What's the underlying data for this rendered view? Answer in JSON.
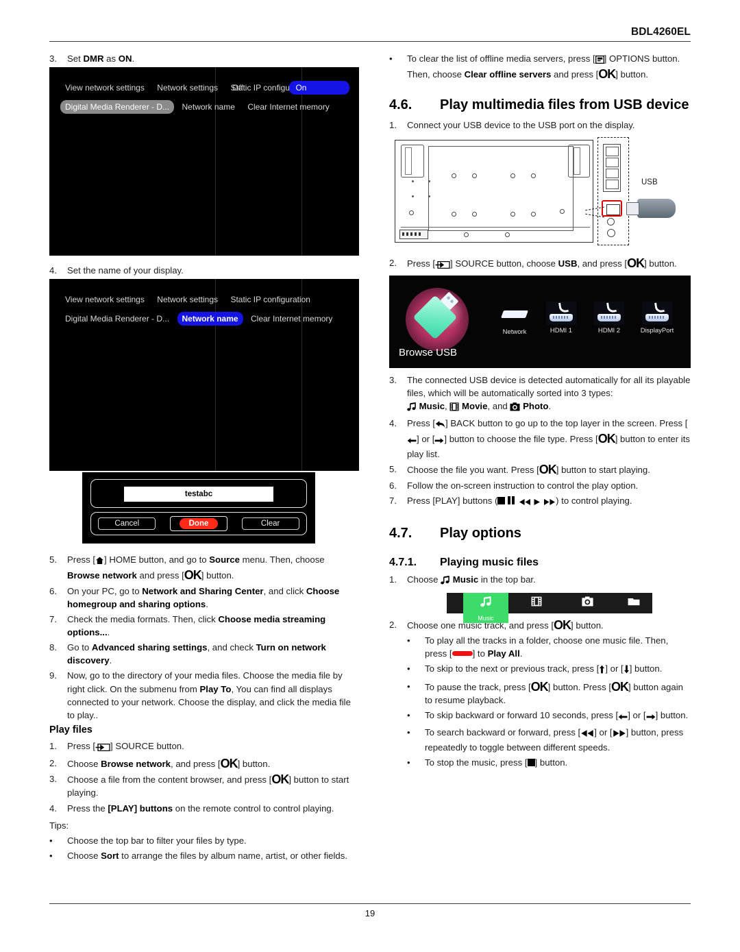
{
  "header": {
    "model": "BDL4260EL"
  },
  "footer": {
    "page_number": "19"
  },
  "left": {
    "step3": {
      "num": "3.",
      "pre": "Set ",
      "b1": "DMR",
      "mid": " as ",
      "b2": "ON",
      "post": "."
    },
    "osd1": {
      "items": [
        "View network settings",
        "Network settings",
        "Static IP configuration",
        "Digital Media Renderer - D...",
        "Network name",
        "Clear Internet memory"
      ],
      "selected_index": 3,
      "options": [
        "Off",
        "On"
      ],
      "option_selected": "On"
    },
    "step4": {
      "num": "4.",
      "text": "Set the name of your display."
    },
    "osd2": {
      "items": [
        "View network settings",
        "Network settings",
        "Static IP configuration",
        "Digital Media Renderer - D...",
        "Network name",
        "Clear Internet memory"
      ],
      "selected_index": 4
    },
    "keyboard_dialog": {
      "field_value": "testabc",
      "cancel": "Cancel",
      "done": "Done",
      "clear": "Clear"
    },
    "step5": {
      "num": "5.",
      "p1": "Press ",
      "icon": "home-icon",
      "p2": "] HOME button, and go to ",
      "b1": "Source",
      "p3": " menu. Then, choose ",
      "b2": "Browse network",
      "p4": " and press [",
      "ok": "OK",
      "p5": "] button."
    },
    "step6": {
      "num": "6.",
      "p1": "On your PC, go to ",
      "b1": "Network and Sharing Center",
      "p2": ", and click ",
      "b2": "Choose homegroup and sharing options",
      "p3": "."
    },
    "step7": {
      "num": "7.",
      "p1": "Check the media formats. Then, click ",
      "b1": "Choose media streaming options...",
      "p2": "."
    },
    "step8": {
      "num": "8.",
      "p1": "Go to ",
      "b1": "Advanced sharing settings",
      "p2": ", and check ",
      "b2": "Turn on network discovery",
      "p3": "."
    },
    "step9": {
      "num": "9.",
      "p1": "Now, go to the directory of your media files. Choose the media file by right click. On the submenu from ",
      "b1": "Play To",
      "p2": ", You can find all displays connected to your network. Choose the display, and click the media file to play.."
    },
    "play_files_title": "Play files",
    "pf1": {
      "num": "1.",
      "p1": "Press [",
      "icon": "source-icon",
      "p2": "] SOURCE button."
    },
    "pf2": {
      "num": "2.",
      "p1": "Choose ",
      "b1": "Browse network",
      "p2": ", and press [",
      "ok": "OK",
      "p3": "] button."
    },
    "pf3": {
      "num": "3.",
      "p1": "Choose a file from the content browser, and press [",
      "ok": "OK",
      "p2": "] button to start playing."
    },
    "pf4": {
      "num": "4.",
      "p1": "Press the ",
      "b1": "[PLAY] buttons",
      "p2": " on the remote control to control playing."
    },
    "tips_label": "Tips:",
    "tip1": "Choose the top bar to filter your files by type.",
    "tip2": {
      "p1": "Choose ",
      "b1": "Sort",
      "p2": " to arrange the files by album name, artist, or other fields."
    }
  },
  "right": {
    "bullet_clear": {
      "p1": "To clear the list of offline media servers, press [",
      "icon": "options-icon",
      "p2": "] OPTIONS button. Then, choose ",
      "b1": "Clear offline servers",
      "p3": " and press [",
      "ok": "OK",
      "p4": "] button."
    },
    "h46": {
      "num": "4.6.",
      "title_pre": "Play multimedia files from ",
      "title_b": "USB",
      "title_post": " device"
    },
    "s1": {
      "num": "1.",
      "text": "Connect your USB device to the USB port on the display."
    },
    "diagram": {
      "usb_label": "USB"
    },
    "s2": {
      "num": "2.",
      "p1": "Press [",
      "icon": "source-icon",
      "p2": "] SOURCE button, choose ",
      "b1": "USB",
      "p3": ", and press [",
      "ok": "OK",
      "p4": "] button."
    },
    "source_screen": {
      "browse_usb": "Browse USB",
      "items": [
        "Network",
        "HDMI 1",
        "HDMI 2",
        "DisplayPort"
      ]
    },
    "s3": {
      "num": "3.",
      "p1": "The connected USB device is detected automatically for all its playable files, which will be automatically sorted into 3 types:",
      "music": "Music",
      "movie": "Movie",
      "photo": "Photo",
      "sep1": ", ",
      "sep2": ", and ",
      "end": "."
    },
    "s4": {
      "num": "4.",
      "p1": "Press [",
      "icon": "back-icon",
      "p2": "] BACK button to go up to the top layer in the screen. Press [",
      "left": "left-arrow-icon",
      "p3": "] or [",
      "right": "right-arrow-icon",
      "p4": "] button to choose the file type. Press [",
      "ok": "OK",
      "p5": "] button to enter its play list."
    },
    "s5": {
      "num": "5.",
      "p1": "Choose the file you want. Press [",
      "ok": "OK",
      "p2": "] button to start playing."
    },
    "s6": {
      "num": "6.",
      "text": "Follow the on-screen instruction to control the play option."
    },
    "s7": {
      "num": "7.",
      "p1": "Press [PLAY] buttons (",
      "p2": ") to control playing."
    },
    "h47": {
      "num": "4.7.",
      "title": "Play options"
    },
    "h471": {
      "num": "4.7.1.",
      "title": "Playing music files"
    },
    "m1": {
      "num": "1.",
      "p1": "Choose ",
      "b1": "Music",
      "p2": " in the top bar."
    },
    "topbar": {
      "tabs": [
        "music-icon",
        "movie-icon",
        "photo-icon",
        "folder-icon"
      ],
      "active_label": "Music",
      "active_color": "#3ddc6a"
    },
    "m2": {
      "num": "2.",
      "p1": "Choose one music track, and press [",
      "ok": "OK",
      "p2": "] button."
    },
    "mb1": {
      "p1": "To play all the tracks in a folder, choose one music file. Then, press [",
      "p2": "] to ",
      "b1": "Play All",
      "p3": "."
    },
    "mb2": {
      "p1": "To skip to the next or previous track, press [",
      "p2": "] or [",
      "p3": "] button."
    },
    "mb3": {
      "p1": "To pause the track, press [",
      "ok1": "OK",
      "p2": "] button. Press [",
      "ok2": "OK",
      "p3": "] button again to resume playback."
    },
    "mb4": {
      "p1": "To skip backward or forward 10 seconds, press [",
      "p2": "] or [",
      "p3": "] button."
    },
    "mb5": {
      "p1": "To search backward or forward, press [",
      "p2": "] or [",
      "p3": "] button, press repeatedly to toggle between different speeds."
    },
    "mb6": {
      "p1": "To stop the music, press [",
      "p2": "] button."
    }
  }
}
